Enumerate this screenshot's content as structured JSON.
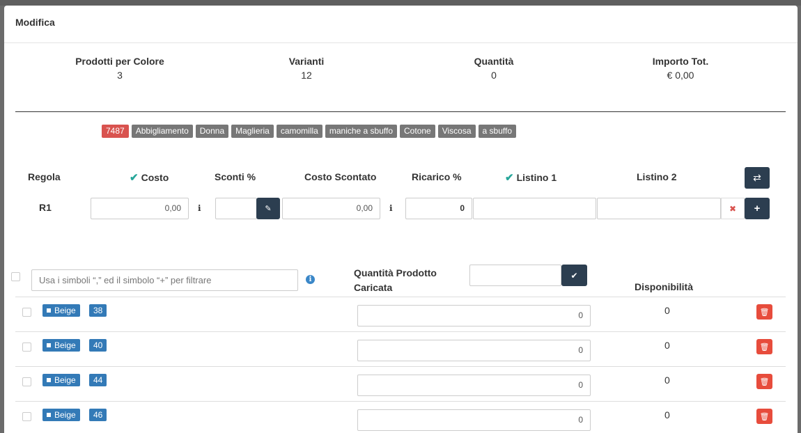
{
  "modal": {
    "title": "Modifica"
  },
  "summary": [
    {
      "label": "Prodotti per Colore",
      "value": "3"
    },
    {
      "label": "Varianti",
      "value": "12"
    },
    {
      "label": "Quantità",
      "value": "0"
    },
    {
      "label": "Importo Tot.",
      "value": "€ 0,00"
    }
  ],
  "tags": [
    "7487",
    "Abbigliamento",
    "Donna",
    "Maglieria",
    "camomilla",
    "maniche a sbuffo",
    "Cotone",
    "Viscosa",
    "a sbuffo"
  ],
  "rule_headers": {
    "regola": "Regola",
    "costo": "Costo",
    "sconti": "Sconti %",
    "costo_scontato": "Costo Scontato",
    "ricarico": "Ricarico %",
    "listino1": "Listino 1",
    "listino2": "Listino 2"
  },
  "rule_row": {
    "label": "R1",
    "costo": "0,00",
    "sconti": "",
    "costo_scontato": "0,00",
    "ricarico": "0",
    "listino1": "",
    "listino2": ""
  },
  "filter": {
    "placeholder": "Usa i simboli “,” ed il simbolo “+” per filtrare",
    "qty_label_line1": "Quantità Prodotto",
    "qty_label_line2": "Caricata",
    "disponibilita_label": "Disponibilità"
  },
  "rows": [
    {
      "color": "Beige",
      "size": "38",
      "qty": "0",
      "disponibilita": "0"
    },
    {
      "color": "Beige",
      "size": "40",
      "qty": "0",
      "disponibilita": "0"
    },
    {
      "color": "Beige",
      "size": "44",
      "qty": "0",
      "disponibilita": "0"
    },
    {
      "color": "Beige",
      "size": "46",
      "qty": "0",
      "disponibilita": "0"
    }
  ],
  "colors": {
    "dark_button": "#2c3e50",
    "tag_red": "#d9534f",
    "badge_blue": "#337ab7",
    "delete_red": "#e74c3c",
    "check_teal": "#26a69a"
  }
}
